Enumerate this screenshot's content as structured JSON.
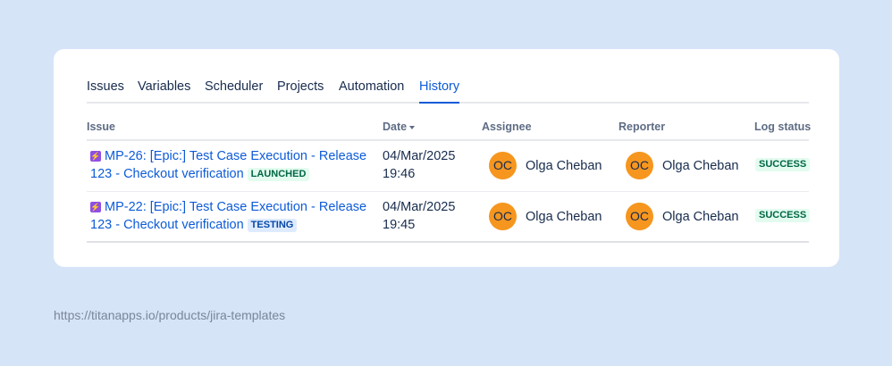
{
  "tabs": [
    "Issues",
    "Variables",
    "Scheduler",
    "Projects",
    "Automation",
    "History"
  ],
  "active_tab": "History",
  "columns": {
    "issue": "Issue",
    "date": "Date",
    "assignee": "Assignee",
    "reporter": "Reporter",
    "log_status": "Log status"
  },
  "rows": [
    {
      "issue_line1": "MP-26: [Epic:] Test Case Execution - Release",
      "issue_line2": "123 - Checkout verification",
      "issue_status": "LAUNCHED",
      "date": "04/Mar/2025",
      "time": "19:46",
      "assignee_initials": "OC",
      "assignee": "Olga Cheban",
      "reporter_initials": "OC",
      "reporter": "Olga Cheban",
      "log_status": "SUCCESS"
    },
    {
      "issue_line1": "MP-22: [Epic:] Test Case Execution - Release",
      "issue_line2": "123 - Checkout verification",
      "issue_status": "TESTING",
      "date": "04/Mar/2025",
      "time": "19:45",
      "assignee_initials": "OC",
      "assignee": "Olga Cheban",
      "reporter_initials": "OC",
      "reporter": "Olga Cheban",
      "log_status": "SUCCESS"
    }
  ],
  "footer_url": "https://titanapps.io/products/jira-templates",
  "icons": {
    "epic": "lightning-bolt-icon",
    "sort": "sort-down-icon"
  },
  "colors": {
    "link": "#0c5bd8",
    "epic": "#904ee2",
    "avatar": "#f6961e",
    "success_bg": "#e3fcef",
    "success_text": "#006644",
    "testing_bg": "#deebff",
    "testing_text": "#0747a6",
    "page_bg": "#d6e4f8"
  }
}
